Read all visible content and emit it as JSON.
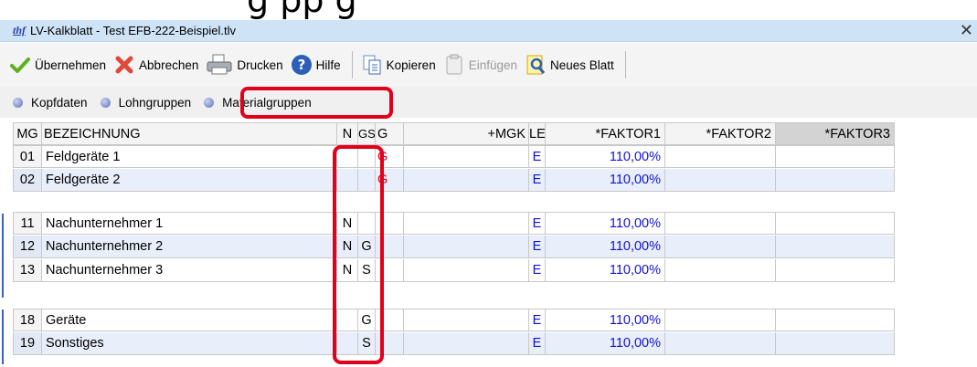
{
  "caption_crop": "g  pp                  g",
  "window": {
    "logo": "thf",
    "title": "LV-Kalkblatt - Test EFB-222-Beispiel.tlv",
    "close": "✕"
  },
  "toolbar": {
    "uebernehmen": "Übernehmen",
    "abbrechen": "Abbrechen",
    "drucken": "Drucken",
    "hilfe": "Hilfe",
    "kopieren": "Kopieren",
    "einfuegen": "Einfügen",
    "neues_blatt": "Neues Blatt"
  },
  "tabs": [
    "Kopfdaten",
    "Lohngruppen",
    "Materialgruppen"
  ],
  "active_tab": "Materialgruppen",
  "colors": {
    "highlight": "#e2001a",
    "blue_value": "#1010d8",
    "alt_row": "#e8eefa"
  },
  "table": {
    "headers": {
      "mg": "MG",
      "bez": "BEZEICHNUNG",
      "n": "N",
      "gs": "GS",
      "g": "G",
      "mgk": "+MGK",
      "le": "LE",
      "f1": "*FAKTOR1",
      "f2": "*FAKTOR2",
      "f3": "*FAKTOR3"
    },
    "groups": [
      [
        {
          "mg": "01",
          "bez": "Feldgeräte 1",
          "n": "",
          "gs": "",
          "g": "G",
          "le": "E",
          "f1": "110,00%"
        },
        {
          "mg": "02",
          "bez": "Feldgeräte 2",
          "n": "",
          "gs": "",
          "g": "G",
          "le": "E",
          "f1": "110,00%"
        }
      ],
      [
        {
          "mg": "11",
          "bez": "Nachunternehmer 1",
          "n": "N",
          "gs": "",
          "g": "",
          "le": "E",
          "f1": "110,00%"
        },
        {
          "mg": "12",
          "bez": "Nachunternehmer 2",
          "n": "N",
          "gs": "G",
          "g": "",
          "le": "E",
          "f1": "110,00%"
        },
        {
          "mg": "13",
          "bez": "Nachunternehmer 3",
          "n": "N",
          "gs": "S",
          "g": "",
          "le": "E",
          "f1": "110,00%"
        }
      ],
      [
        {
          "mg": "18",
          "bez": "Geräte",
          "n": "",
          "gs": "G",
          "g": "",
          "le": "E",
          "f1": "110,00%"
        },
        {
          "mg": "19",
          "bez": "Sonstiges",
          "n": "",
          "gs": "S",
          "g": "",
          "le": "E",
          "f1": "110,00%"
        }
      ]
    ]
  }
}
